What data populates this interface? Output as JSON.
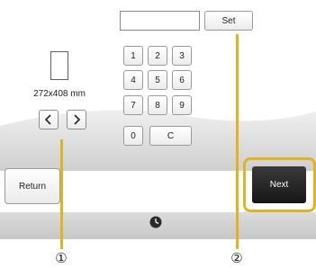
{
  "size_panel": {
    "size_label": "272x408 mm",
    "prev_icon": "chevron-left-icon",
    "next_icon": "chevron-right-icon"
  },
  "keypad": {
    "input_value": "",
    "set_label": "Set",
    "keys": [
      "1",
      "2",
      "3",
      "4",
      "5",
      "6",
      "7",
      "8",
      "9",
      "0",
      "C"
    ]
  },
  "footer": {
    "return_label": "Return",
    "next_label": "Next",
    "clock_icon": "clock-icon"
  },
  "callouts": [
    "①",
    "②"
  ],
  "colors": {
    "highlight": "#e0b324",
    "next_button": "#1f1f1f",
    "wave": "#d9d9d9"
  }
}
